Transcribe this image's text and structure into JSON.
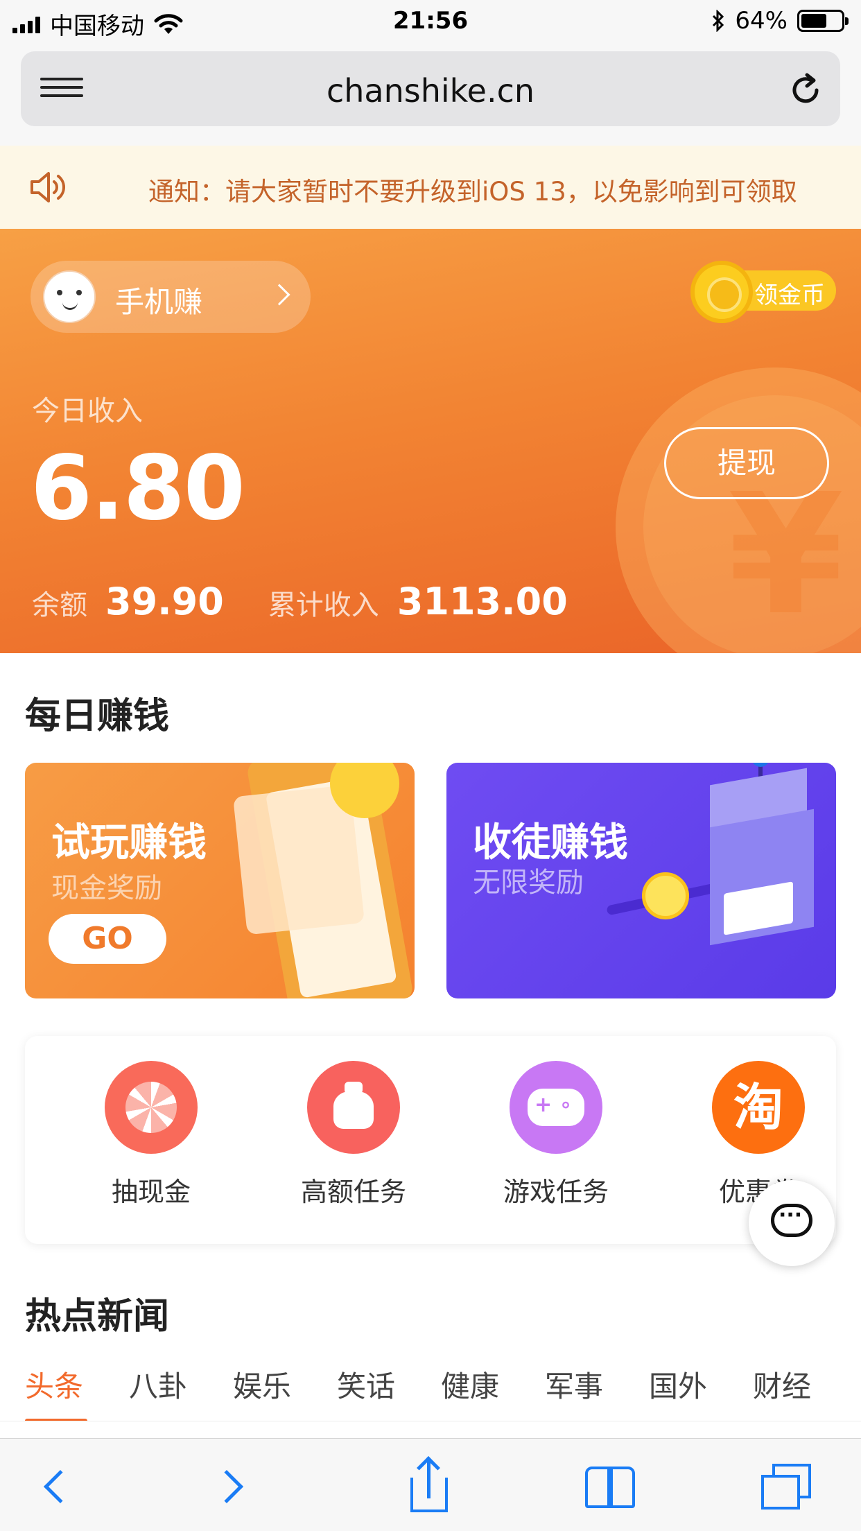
{
  "status_bar": {
    "carrier": "中国移动",
    "time": "21:56",
    "battery": "64%",
    "battery_level": 0.64
  },
  "address_bar": {
    "url": "chanshike.cn",
    "menu_icon": "hamburger-icon",
    "reload_icon": "reload-icon"
  },
  "notice": {
    "text": "通知：请大家暂时不要升级到iOS 13，以免影响到可领取"
  },
  "hero": {
    "user_name": "手机赚",
    "coin_label": "领金币",
    "today_label": "今日收入",
    "today_value": "6.80",
    "withdraw_label": "提现",
    "balance_label": "余额",
    "balance_value": "39.90",
    "total_label": "累计收入",
    "total_value": "3113.00"
  },
  "daily": {
    "title": "每日赚钱",
    "cards": [
      {
        "title": "试玩赚钱",
        "subtitle": "现金奖励",
        "button": "GO"
      },
      {
        "title": "收徒赚钱",
        "subtitle": "无限奖励"
      }
    ]
  },
  "quick_menu": [
    {
      "label": "抽现金",
      "icon": "wheel-icon"
    },
    {
      "label": "高额任务",
      "icon": "money-bag-icon"
    },
    {
      "label": "游戏任务",
      "icon": "gamepad-icon"
    },
    {
      "label": "优惠券",
      "icon": "taobao-icon",
      "glyph": "淘"
    }
  ],
  "news": {
    "title": "热点新闻",
    "tabs": [
      "头条",
      "八卦",
      "娱乐",
      "笑话",
      "健康",
      "军事",
      "国外",
      "财经"
    ],
    "active_tab": "头条"
  },
  "colors": {
    "accent": "#f26a2c",
    "ios_blue": "#1a7cf5",
    "notice_text": "#c4632a"
  }
}
